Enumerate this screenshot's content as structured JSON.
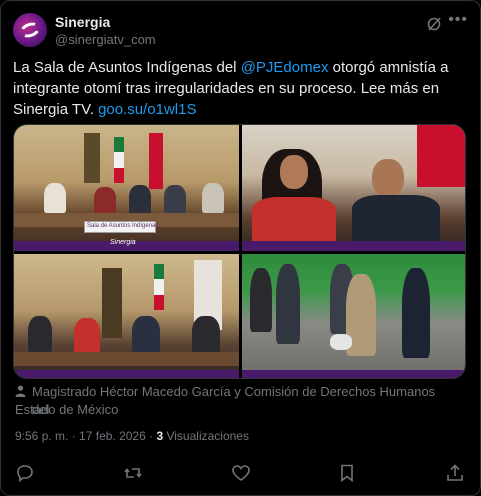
{
  "account": {
    "name": "Sinergia",
    "handle": "@sinergiatv_com"
  },
  "tweet": {
    "text_before": "La Sala de Asuntos Indígenas del ",
    "mention": "@PJEdomex",
    "text_middle": " otorgó amnistía a integrante otomí tras irregularidades en su proceso. Lee más en Sinergia TV. ",
    "link": "goo.su/o1wl1S"
  },
  "media": {
    "photo_1_sign": "Sala de Asuntos Indígenas",
    "photo_watermark": "Sinergia"
  },
  "caption": {
    "line1": "Magistrado Héctor Macedo García y Comisión de Derechos Humanos del",
    "line2": "Estado de México"
  },
  "meta": {
    "time": "9:56 p. m.",
    "separator": " · ",
    "date": "17 feb. 2026",
    "views_count": "3",
    "views_label": " Visualizaciones"
  },
  "icons": {
    "grok": "grok-icon",
    "more": "more-icon",
    "reply": "reply-icon",
    "retweet": "retweet-icon",
    "like": "like-icon",
    "bookmark": "bookmark-icon",
    "share": "share-icon"
  },
  "colors": {
    "background": "#000000",
    "text": "#e7e9ea",
    "muted": "#71767b",
    "accent": "#1d9bf0"
  }
}
